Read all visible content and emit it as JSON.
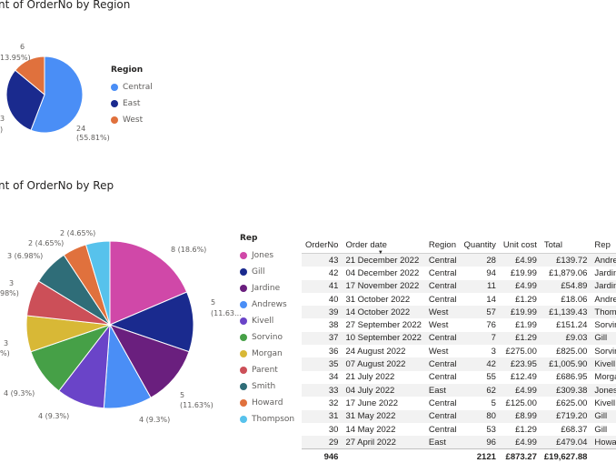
{
  "region_chart": {
    "title": "nt of OrderNo by Region",
    "legend_title": "Region",
    "labels": [
      {
        "text": "6",
        "color": "#605e5c"
      },
      {
        "text": "13.95%)"
      },
      {
        "text": "3"
      },
      {
        "text": ")"
      },
      {
        "text": "24"
      },
      {
        "text": "(55.81%)"
      }
    ]
  },
  "rep_chart": {
    "title": "nt of OrderNo by Rep",
    "legend_title": "Rep",
    "labels": {
      "l1": "8 (18.6%)",
      "l2a": "5",
      "l2b": "(11.63...",
      "l3a": "5",
      "l3b": "(11.63%)",
      "l4": "4 (9.3%)",
      "l5": "4 (9.3%)",
      "l6": "4 (9.3%)",
      "l7a": "3",
      "l7b": "%)",
      "l8a": "3",
      "l8b": "98%)",
      "l9": "3 (6.98%)",
      "l10": "2 (4.65%)",
      "l11": "2 (4.65%)"
    }
  },
  "chart_data": [
    {
      "type": "pie",
      "title": "nt of OrderNo by Region",
      "legend_title": "Region",
      "categories": [
        "Central",
        "East",
        "West"
      ],
      "values": [
        24,
        13,
        6
      ],
      "colors": [
        "#4a8ef6",
        "#1a2a8e",
        "#e0713d"
      ]
    },
    {
      "type": "pie",
      "title": "nt of OrderNo by Rep",
      "legend_title": "Rep",
      "categories": [
        "Jones",
        "Gill",
        "Jardine",
        "Andrews",
        "Kivell",
        "Sorvino",
        "Morgan",
        "Parent",
        "Smith",
        "Howard",
        "Thompson"
      ],
      "values": [
        8,
        5,
        5,
        4,
        4,
        4,
        3,
        3,
        3,
        2,
        2
      ],
      "colors": [
        "#d048a8",
        "#1a2a8e",
        "#6a1f7e",
        "#4a8ef6",
        "#6a44c8",
        "#46a047",
        "#d8b836",
        "#cc4f58",
        "#2f6d78",
        "#e0713d",
        "#57c2ec"
      ]
    }
  ],
  "table": {
    "columns": [
      "OrderNo",
      "Order date",
      "Region",
      "Quantity",
      "Unit cost",
      "Total",
      "Rep"
    ],
    "rows": [
      [
        "43",
        "21 December 2022",
        "Central",
        "28",
        "£4.99",
        "£139.72",
        "Andre"
      ],
      [
        "42",
        "04 December 2022",
        "Central",
        "94",
        "£19.99",
        "£1,879.06",
        "Jardin"
      ],
      [
        "41",
        "17 November 2022",
        "Central",
        "11",
        "£4.99",
        "£54.89",
        "Jardin"
      ],
      [
        "40",
        "31 October 2022",
        "Central",
        "14",
        "£1.29",
        "£18.06",
        "Andre"
      ],
      [
        "39",
        "14 October 2022",
        "West",
        "57",
        "£19.99",
        "£1,139.43",
        "Thomp"
      ],
      [
        "38",
        "27 September 2022",
        "West",
        "76",
        "£1.99",
        "£151.24",
        "Sorvin"
      ],
      [
        "37",
        "10 September 2022",
        "Central",
        "7",
        "£1.29",
        "£9.03",
        "Gill"
      ],
      [
        "36",
        "24 August 2022",
        "West",
        "3",
        "£275.00",
        "£825.00",
        "Sorvin"
      ],
      [
        "35",
        "07 August 2022",
        "Central",
        "42",
        "£23.95",
        "£1,005.90",
        "Kivell"
      ],
      [
        "34",
        "21 July 2022",
        "Central",
        "55",
        "£12.49",
        "£686.95",
        "Morga"
      ],
      [
        "33",
        "04 July 2022",
        "East",
        "62",
        "£4.99",
        "£309.38",
        "Jones"
      ],
      [
        "32",
        "17 June 2022",
        "Central",
        "5",
        "£125.00",
        "£625.00",
        "Kivell"
      ],
      [
        "31",
        "31 May 2022",
        "Central",
        "80",
        "£8.99",
        "£719.20",
        "Gill"
      ],
      [
        "30",
        "14 May 2022",
        "Central",
        "53",
        "£1.29",
        "£68.37",
        "Gill"
      ],
      [
        "29",
        "27 April 2022",
        "East",
        "96",
        "£4.99",
        "£479.04",
        "Howar"
      ]
    ],
    "totals": [
      "946",
      "",
      "",
      "2121",
      "£873.27",
      "£19,627.88",
      ""
    ]
  }
}
